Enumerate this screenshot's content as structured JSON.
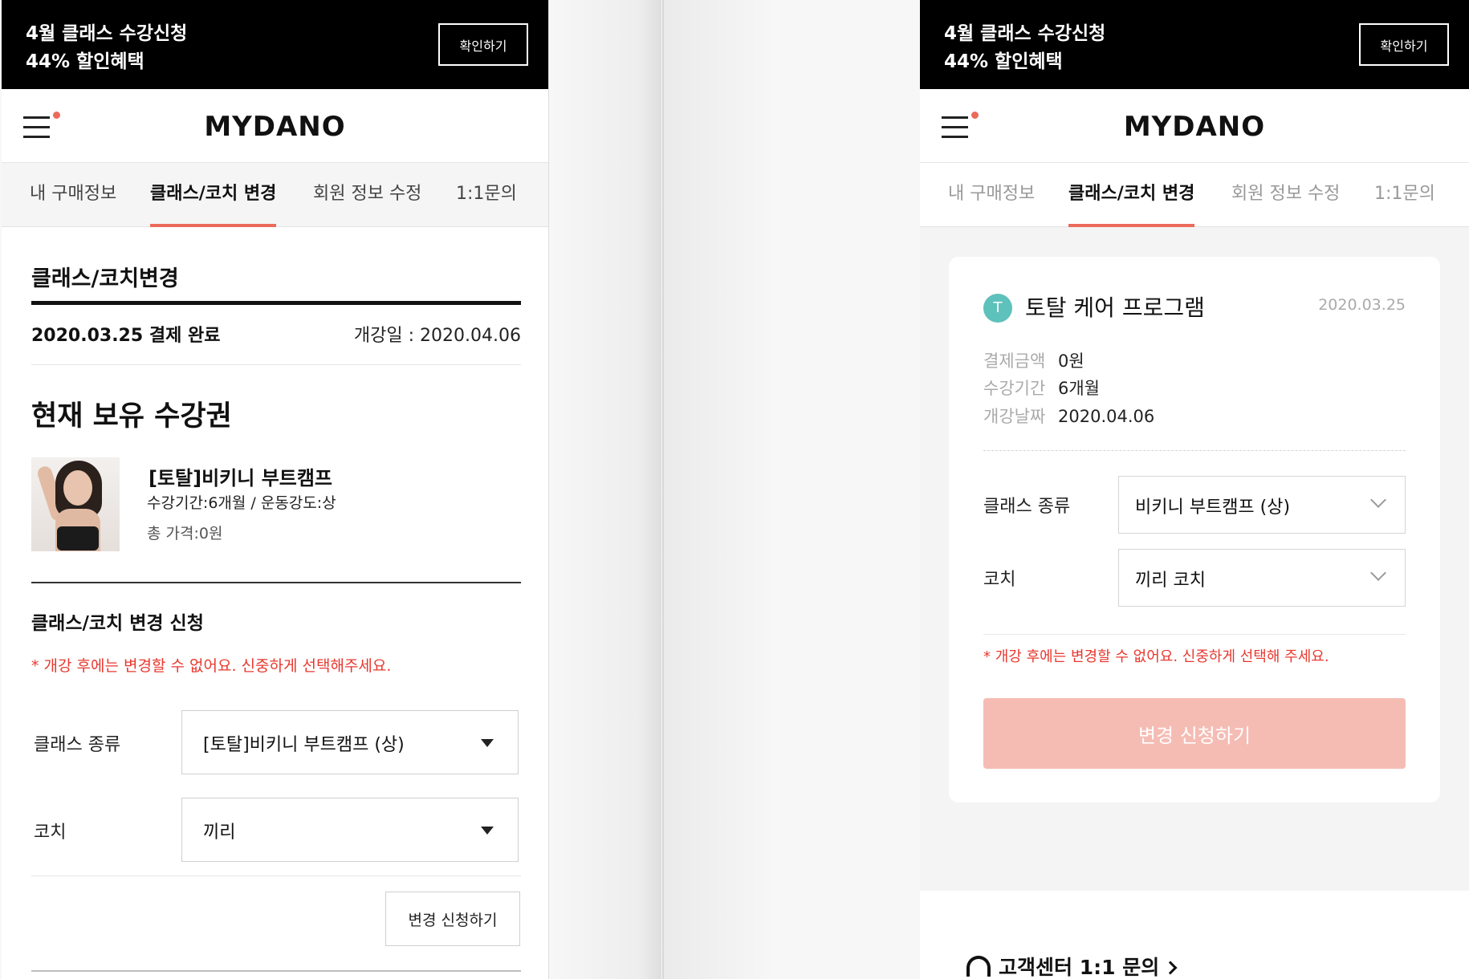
{
  "promo": {
    "line1": "4월 클래스 수강신청",
    "line2": "44% 할인혜택",
    "button": "확인하기"
  },
  "brand": "MYDANO",
  "tabs": [
    "내 구매정보",
    "클래스/코치 변경",
    "회원 정보 수정",
    "1:1문의"
  ],
  "active_tab": "클래스/코치 변경",
  "left": {
    "section_title": "클래스/코치변경",
    "paid": "2020.03.25 결제 완료",
    "open_date": "개강일 : 2020.04.06",
    "current_title": "현재 보유 수강권",
    "product": {
      "name": "[토탈]비키니 부트캠프",
      "meta": "수강기간:6개월 / 운동강도:상",
      "price": "총 가격:0원"
    },
    "request_title": "클래스/코치 변경 신청",
    "warning": "* 개강 후에는 변경할 수 없어요. 신중하게 선택해주세요.",
    "class_label": "클래스 종류",
    "class_value": "[토탈]비키니 부트캠프 (상)",
    "coach_label": "코치",
    "coach_value": "끼리",
    "submit": "변경 신청하기"
  },
  "right": {
    "badge": "T",
    "program_name": "토탈 케어 프로그램",
    "date": "2020.03.25",
    "info": [
      {
        "k": "결제금액",
        "v": "0원"
      },
      {
        "k": "수강기간",
        "v": "6개월"
      },
      {
        "k": "개강날짜",
        "v": "2020.04.06"
      }
    ],
    "class_label": "클래스 종류",
    "class_value": "비키니 부트캠프 (상)",
    "coach_label": "코치",
    "coach_value": "끼리 코치",
    "warning": "* 개강 후에는 변경할 수 없어요. 신중하게 선택해 주세요.",
    "submit": "변경 신청하기",
    "support": "고객센터 1:1 문의"
  },
  "colors": {
    "accent": "#ec6a5a",
    "warning": "#e8382f",
    "button_disabled": "#f5bcb4",
    "badge": "#5fc1bb"
  }
}
